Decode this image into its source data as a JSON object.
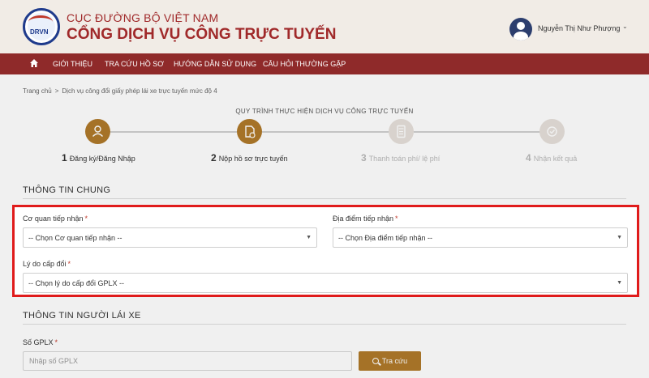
{
  "header": {
    "org_name": "CỤC ĐƯỜNG BỘ VIỆT NAM",
    "portal_name": "CỔNG DỊCH VỤ CÔNG TRỰC TUYẾN",
    "logo_text": "DRVN",
    "user_name": "Nguyễn Thị Như Phượng",
    "user_menu_icon": "chevron-down-icon"
  },
  "nav": {
    "home_icon": "home-icon",
    "items": [
      "GIỚI THIỆU",
      "TRA CỨU HỒ SƠ",
      "HƯỚNG DẪN SỬ DỤNG",
      "CÂU HỎI THƯỜNG GẶP"
    ]
  },
  "breadcrumb": {
    "home": "Trang chủ",
    "separator": ">",
    "current": "Dịch vụ công đổi giấy phép lái xe trực tuyến mức độ 4"
  },
  "process": {
    "title": "QUY TRÌNH THỰC HIỆN DỊCH VỤ CÔNG TRỰC TUYẾN",
    "steps": [
      {
        "num": "1",
        "label": "Đăng ký/Đăng Nhập",
        "state": "done",
        "icon": "user-icon"
      },
      {
        "num": "2",
        "label": "Nộp hồ sơ trực tuyến",
        "state": "current",
        "icon": "document-icon"
      },
      {
        "num": "3",
        "label": "Thanh toán phí/ lệ phí",
        "state": "pending",
        "icon": "calculator-icon"
      },
      {
        "num": "4",
        "label": "Nhận kết quả",
        "state": "pending",
        "icon": "check-circle-icon"
      }
    ]
  },
  "general_info": {
    "title": "THÔNG TIN CHUNG",
    "agency": {
      "label": "Cơ quan tiếp nhận",
      "required": "*",
      "value": "-- Chọn Cơ quan tiếp nhận --"
    },
    "location": {
      "label": "Địa điểm tiếp nhận",
      "required": "*",
      "value": "-- Chọn Địa điểm tiếp nhận --"
    },
    "reason": {
      "label": "Lý do cấp đổi",
      "required": "*",
      "value": "-- Chọn lý do cấp đổi GPLX --"
    }
  },
  "driver_info": {
    "title": "THÔNG TIN NGƯỜI LÁI XE",
    "license": {
      "label": "Số GPLX",
      "required": "*",
      "placeholder": "Nhập số GPLX"
    },
    "search_button": "Tra cứu"
  },
  "colors": {
    "brand_red": "#a0292a",
    "nav_bg": "#8f2a2a",
    "accent_gold": "#b07a2a",
    "highlight_red": "#e01b1b"
  }
}
